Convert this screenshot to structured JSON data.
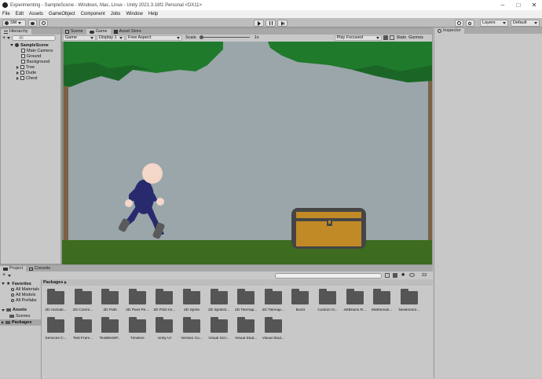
{
  "window": {
    "title": "Experimenting - SampleScene - Windows, Mac, Linux - Unity 2021.3.16f1 Personal <DX11>",
    "minimize_icon": "minimize-icon",
    "maximize_icon": "maximize-icon",
    "close_icon": "close-icon"
  },
  "menu": [
    "File",
    "Edit",
    "Assets",
    "GameObject",
    "Component",
    "Jobs",
    "Window",
    "Help"
  ],
  "toolbar": {
    "account_label": "SM",
    "layers_label": "Layers",
    "layout_label": "Default"
  },
  "hierarchy": {
    "tab_label": "Hierarchy",
    "search_placeholder": "All",
    "scene": "SampleScene",
    "items": [
      "Main Camera",
      "Ground",
      "Background",
      "Tree",
      "Dude",
      "Chest"
    ]
  },
  "view_tabs": [
    "Scene",
    "Game",
    "Asset Store"
  ],
  "game_toolbar": {
    "display_mode": "Game",
    "display": "Display 1",
    "aspect": "Free Aspect",
    "scale_label": "Scale",
    "scale_value": "1x",
    "play_mode": "Play Focused",
    "stats": "Stats",
    "gizmos": "Gizmos"
  },
  "inspector": {
    "tab_label": "Inspector"
  },
  "project": {
    "tabs": [
      "Project",
      "Console"
    ],
    "hidden_count": "23",
    "tree": {
      "favorites": "Favorites",
      "favorite_items": [
        "All Materials",
        "All Models",
        "All Prefabs"
      ],
      "assets": "Assets",
      "asset_items": [
        "Scenes"
      ],
      "packages": "Packages"
    },
    "breadcrumb": "Packages",
    "folders": [
      "2D Animati...",
      "2D Comm...",
      "2D Path",
      "2D Pixel Pe...",
      "2D PSD Im...",
      "2D Sprite",
      "2D SpriteS...",
      "2D Tilemap...",
      "2D Tilemap...",
      "Burst",
      "Custom N...",
      "JetBrains R...",
      "Mathemati...",
      "Newtonsof...",
      "Services C...",
      "Test Fram...",
      "TextMeshP...",
      "Timeline",
      "Unity UI",
      "Version Co...",
      "Visual Scri...",
      "Visual Stud...",
      "Visual Stud..."
    ]
  }
}
